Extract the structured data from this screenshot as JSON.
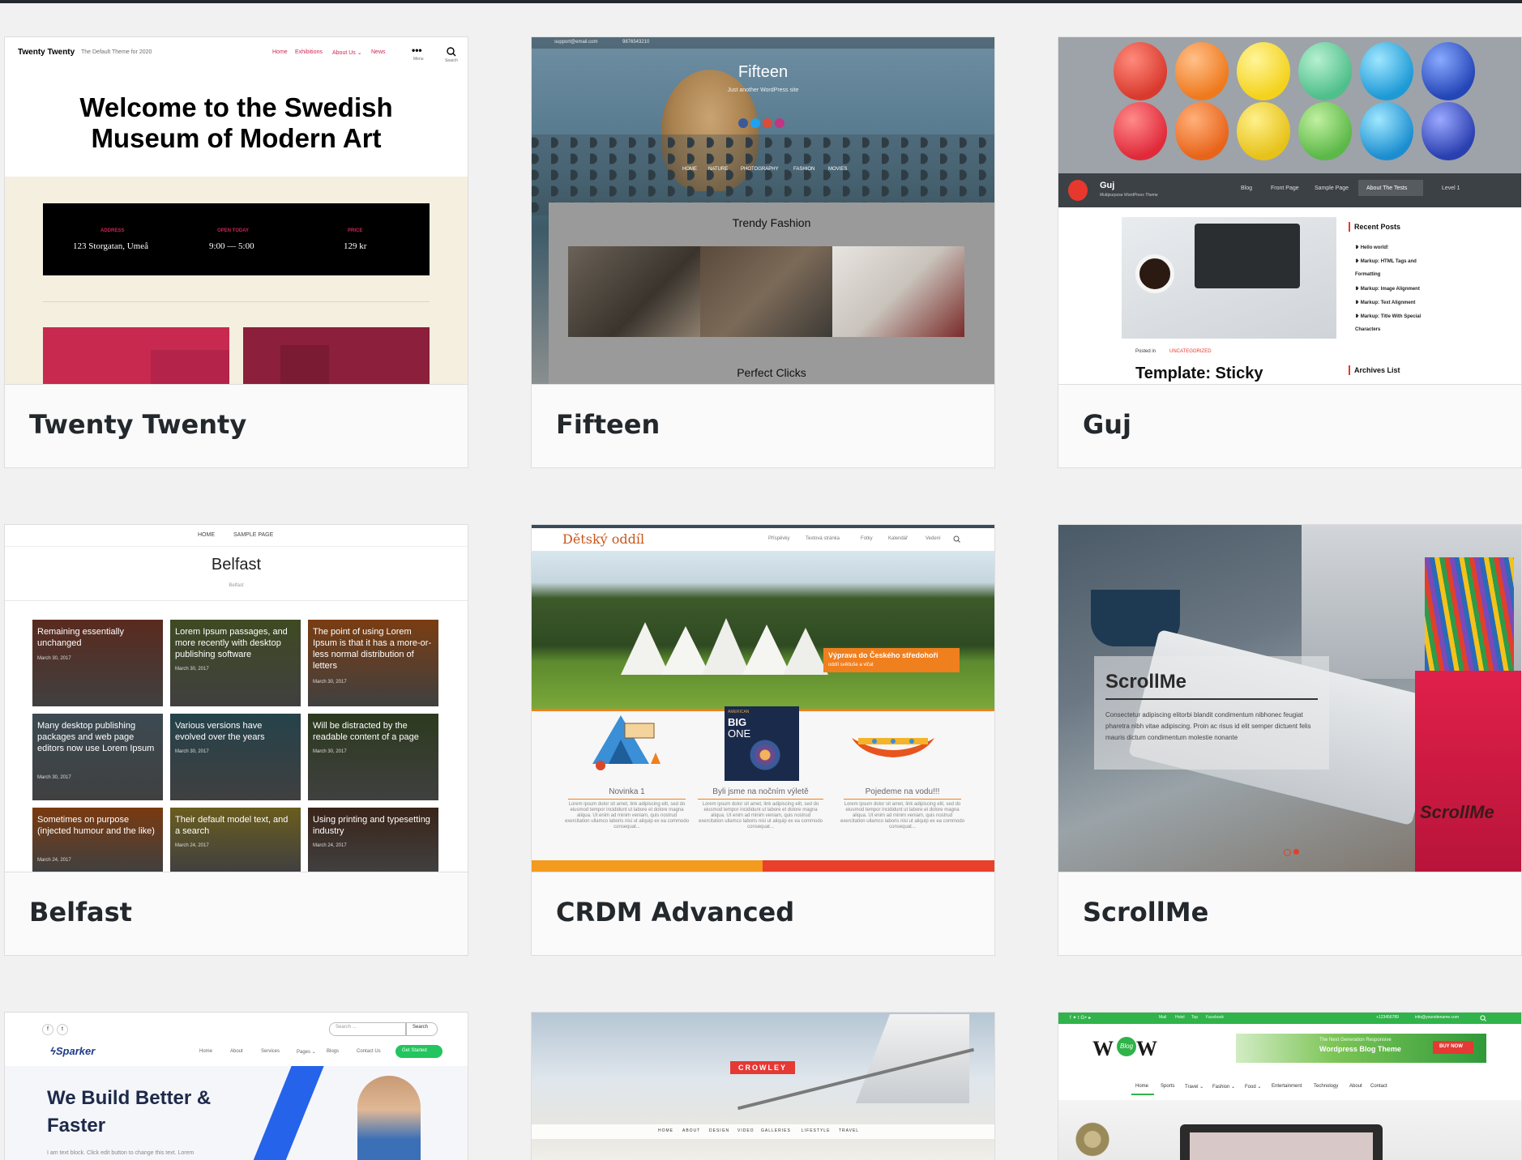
{
  "themes": [
    {
      "name": "Twenty Twenty"
    },
    {
      "name": "Fifteen"
    },
    {
      "name": "Guj"
    },
    {
      "name": "Belfast"
    },
    {
      "name": "CRDM Advanced"
    },
    {
      "name": "ScrollMe"
    },
    {
      "name": ""
    },
    {
      "name": ""
    },
    {
      "name": ""
    }
  ],
  "tt": {
    "site_title": "Twenty Twenty",
    "tagline": "The Default Theme for 2020",
    "nav": [
      "Home",
      "Exhibitions",
      "About Us ⌄",
      "News"
    ],
    "menu_label": "Menu",
    "search_label": "Search",
    "headline1": "Welcome to the Swedish",
    "headline2": "Museum of Modern Art",
    "info": [
      {
        "label": "ADDRESS",
        "value": "123 Storgatan, Umeå"
      },
      {
        "label": "OPEN TODAY",
        "value": "9:00 — 5:00"
      },
      {
        "label": "PRICE",
        "value": "129 kr"
      }
    ]
  },
  "fifteen": {
    "email": "support@email.com",
    "phone": "9876543210",
    "title": "Fifteen",
    "subtitle": "Just another WordPress site",
    "nav": [
      "HOME",
      "NATURE",
      "PHOTOGRAPHY",
      "FASHION",
      "MOVIES"
    ],
    "section1": "Trendy Fashion",
    "section2": "Perfect Clicks"
  },
  "guj": {
    "logo": "Guj",
    "tagline": "Multipurpose WordPress Theme",
    "nav": [
      "Blog",
      "Front Page",
      "Sample Page",
      "About The Tests",
      "Level 1"
    ],
    "recent_heading": "Recent Posts",
    "recent": [
      "Hello world!",
      "Markup: HTML Tags and",
      "Formatting",
      "Markup: Image Alignment",
      "Markup: Text Alignment",
      "Markup: Title With Special",
      "Characters"
    ],
    "posted_in": "Posted in",
    "category": "UNCATEGORIZED",
    "post_title": "Template: Sticky",
    "archives": "Archives List"
  },
  "belfast": {
    "nav": [
      "HOME",
      "SAMPLE PAGE"
    ],
    "title": "Belfast",
    "tagline": "Belfast",
    "tiles": [
      {
        "title": "Remaining essentially unchanged",
        "date": "March 30, 2017",
        "color": "#5a2a1e"
      },
      {
        "title": "Lorem Ipsum passages, and more recently with desktop publishing software",
        "date": "March 30, 2017",
        "color": "#3f4a22"
      },
      {
        "title": "The point of using Lorem Ipsum is that it has a more-or-less normal distribution of letters",
        "date": "March 30, 2017",
        "color": "#7a3d12"
      },
      {
        "title": "Many desktop publishing packages and web page editors now use Lorem Ipsum",
        "date": "March 30, 2017",
        "color": "#3c4a52"
      },
      {
        "title": "Various versions have evolved over the years",
        "date": "March 30, 2017",
        "color": "#25424a"
      },
      {
        "title": "Will be distracted by the readable content of a page",
        "date": "March 30, 2017",
        "color": "#2c3a1e"
      },
      {
        "title": "Sometimes on purpose (injected humour and the like)",
        "date": "March 24, 2017",
        "color": "#7a3a10"
      },
      {
        "title": "Their default model text, and a search",
        "date": "March 24, 2017",
        "color": "#6a5d1e"
      },
      {
        "title": "Using printing and typesetting industry",
        "date": "March 24, 2017",
        "color": "#3a2418"
      }
    ]
  },
  "crdm": {
    "logo": "Dětský oddíl",
    "nav": [
      "Příspěvky",
      "Textová stránka",
      "Fotky",
      "Kalendář",
      "Vedení"
    ],
    "banner_title": "Výprava do Českého středohoří",
    "banner_sub": "oddíl světluše a vlčat",
    "items": [
      "Novinka 1",
      "Byli jsme na nočním výletě",
      "Pojedeme na vodu!!!"
    ],
    "lorem": "Lorem ipsum dolor sit amet, link adipiscing elit, sed do eiusmod tempor incididunt ut labore et dolore magna aliqua. Ut enim ad minim veniam, quis nostrud exercitation ullamco laboris nisi ut aliquip ex ea commodo consequat...",
    "poster_top": "AMERICAN",
    "poster_big": "BIG",
    "poster_one": "ONE"
  },
  "scrollme": {
    "title": "ScrollMe",
    "body": "Consectetur adipiscing elitorbi blandit condimentum nibhonec feugiat pharetra nibh vitae adipiscing. Proin ac risus id elit semper dictuent felis mauris dictum condimentum molestie nonante",
    "watermark": "ScrollMe"
  },
  "sparker": {
    "search_placeholder": "Search ...",
    "search_button": "Search",
    "logo": "Sparker",
    "nav": [
      "Home",
      "About",
      "Services",
      "Pages ⌄",
      "Blogs",
      "Contact Us"
    ],
    "cta": "Get Started",
    "headline1": "We Build Better &",
    "headline2": "Faster",
    "body": "I am text block. Click edit button to change this text. Lorem"
  },
  "crowley": {
    "logo": "CROWLEY",
    "nav": [
      "HOME",
      "ABOUT",
      "DESIGN",
      "VIDEO",
      "GALLERIES",
      "LIFESTYLE",
      "TRAVEL"
    ]
  },
  "wow": {
    "top_links": [
      "Mail",
      "Hotel",
      "Top",
      "Facebook"
    ],
    "phone": "+123456789",
    "email": "info@yoursitename.com",
    "logo_left": "W",
    "logo_mid": "Blog",
    "logo_right": "W",
    "ad_line1": "The Next Generation Responsive",
    "ad_line2": "Wordpress Blog Theme",
    "ad_button": "BUY NOW",
    "nav": [
      "Home",
      "Sports",
      "Travel ⌄",
      "Fashion ⌄",
      "Food ⌄",
      "Entertainment",
      "Technology",
      "About",
      "Contact"
    ]
  }
}
